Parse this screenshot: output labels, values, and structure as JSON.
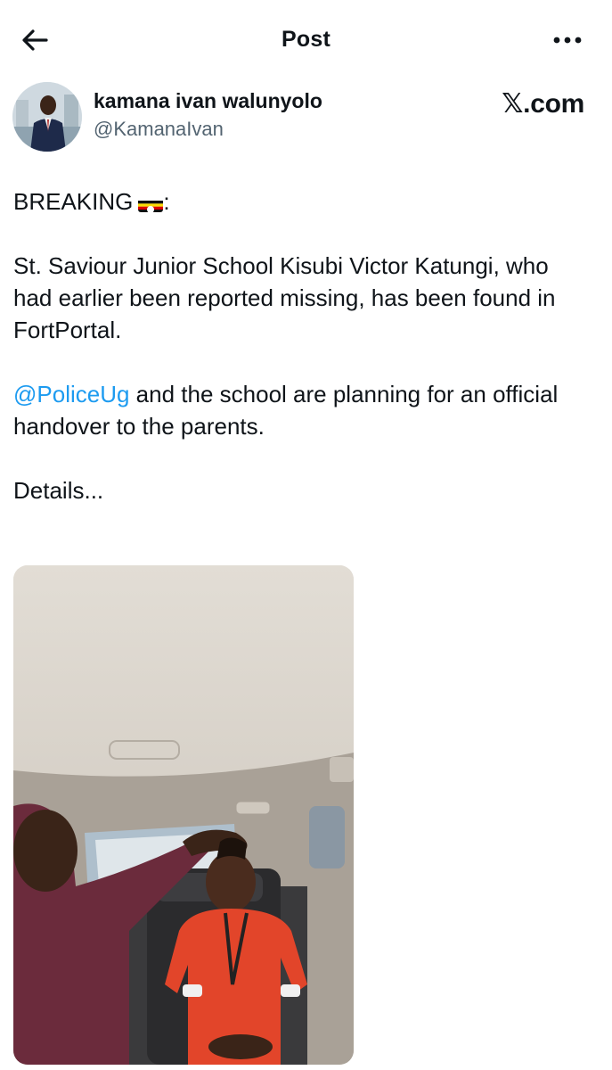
{
  "header": {
    "title": "Post",
    "back_icon": "arrow-left-icon",
    "more_icon": "more-horizontal-icon"
  },
  "author": {
    "display_name": "kamana ivan walunyolo",
    "handle": "@KamanaIvan"
  },
  "watermark": "𝕏.com",
  "tweet": {
    "line1": "BREAKING",
    "flag": "uganda-flag-emoji",
    "line1_suffix": ":",
    "paragraph2": "St. Saviour Junior School Kisubi  Victor Katungi, who had earlier been reported missing, has been found in FortPortal.",
    "mention": "@PoliceUg",
    "paragraph3_rest": " and the school are planning for an official handover to the parents.",
    "paragraph4": "Details..."
  },
  "colors": {
    "accent": "#1d9bf0",
    "text": "#0f1419",
    "secondary": "#536471"
  }
}
